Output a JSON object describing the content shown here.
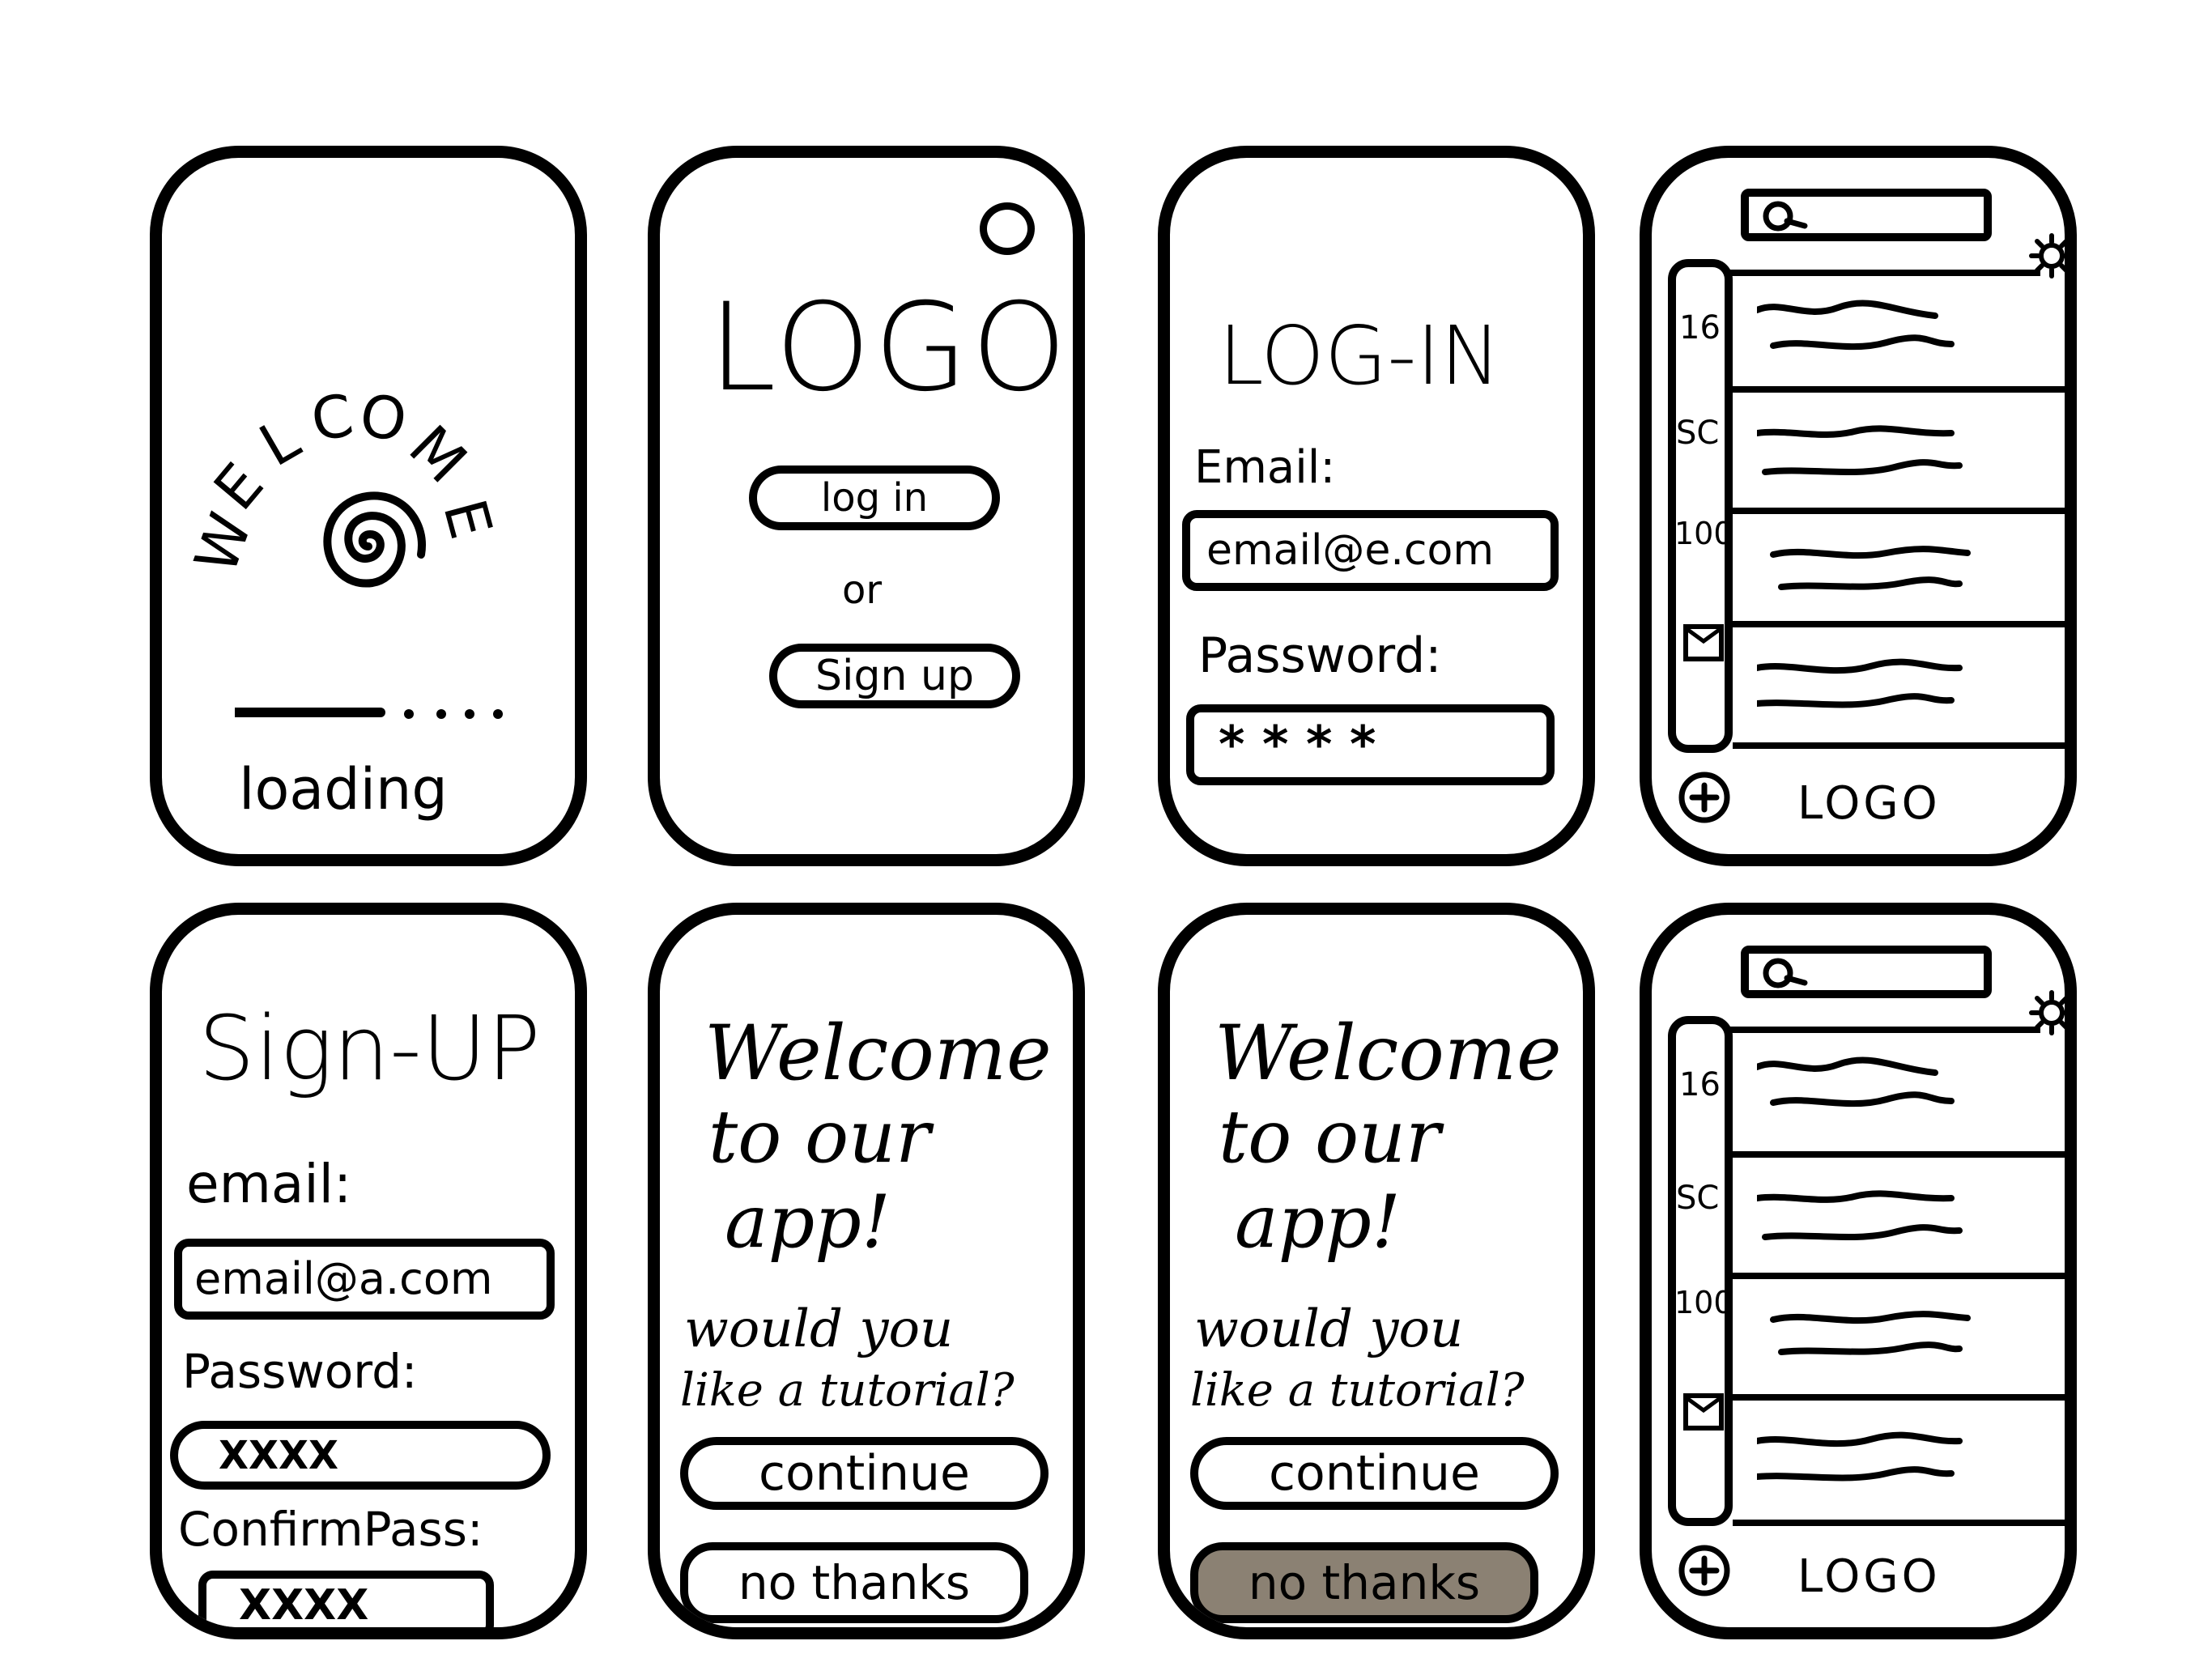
{
  "colors": {
    "ink": "#000000",
    "paper": "#ffffff",
    "pressed": "#8b8173"
  },
  "screens": {
    "splash": {
      "letters": [
        "W",
        "E",
        "L",
        "C",
        "O",
        "M",
        "E"
      ],
      "icon": "spiral-icon",
      "loading_label": "loading"
    },
    "landing": {
      "logo": "LOGO",
      "login_button": "log in",
      "or_label": "or",
      "signup_button": "Sign up"
    },
    "login": {
      "title": "LOG-IN",
      "email_label": "Email:",
      "email_value": "email@e.com",
      "password_label": "Password:",
      "password_value": "* * * *"
    },
    "feed1": {
      "search_icon": "search-icon",
      "settings_icon": "gear-icon",
      "side_items": [
        "16",
        "SC",
        "100"
      ],
      "mail_icon": "mail-icon",
      "add_icon": "plus-icon",
      "footer_logo": "LOGO"
    },
    "signup": {
      "title": "Sign-UP",
      "email_label": "email:",
      "email_value": "email@a.com",
      "password_label": "Password:",
      "password_value": "XXXX",
      "confirm_label": "ConfirmPass:",
      "confirm_value": "XXXX"
    },
    "welcome1": {
      "line1": "Welcome",
      "line2": "to our",
      "line3": "app!",
      "question1": "would you",
      "question2": "like a tutorial?",
      "continue_button": "continue",
      "no_button": "no thanks"
    },
    "welcome2": {
      "line1": "Welcome",
      "line2": "to our",
      "line3": "app!",
      "question1": "would you",
      "question2": "like a tutorial?",
      "continue_button": "continue",
      "no_button": "no thanks",
      "no_button_state": "pressed"
    },
    "feed2": {
      "search_icon": "search-icon",
      "settings_icon": "gear-icon",
      "side_items": [
        "16",
        "SC",
        "100"
      ],
      "mail_icon": "mail-icon",
      "add_icon": "plus-icon",
      "footer_logo": "LOGO"
    }
  }
}
